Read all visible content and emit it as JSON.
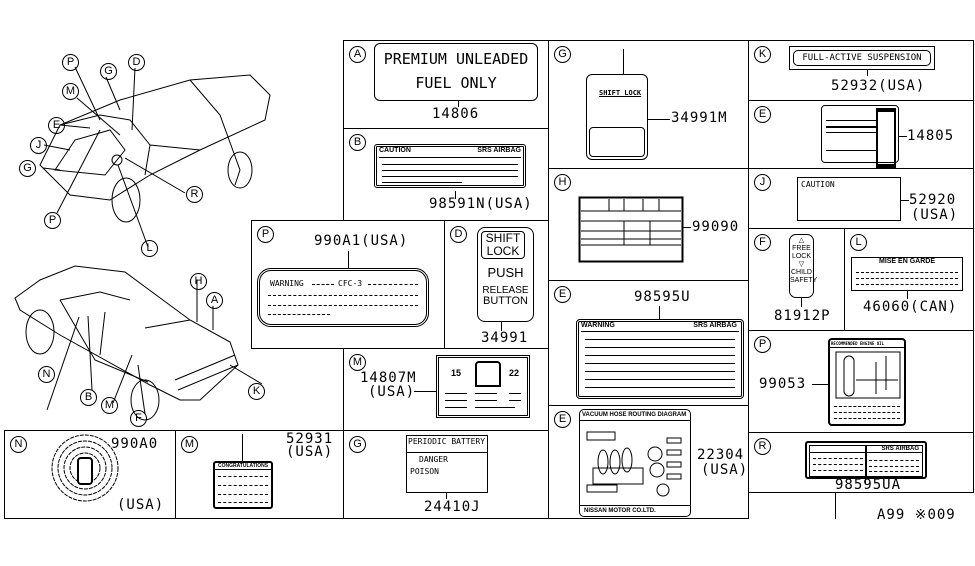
{
  "car_diagrams": {
    "front_car_callouts": [
      "P",
      "G",
      "D",
      "M",
      "E",
      "J",
      "G",
      "R",
      "P",
      "L"
    ],
    "rear_car_callouts": [
      "H",
      "A",
      "N",
      "B",
      "M",
      "F",
      "K"
    ]
  },
  "panels": {
    "A": {
      "letter": "A",
      "part": "14806",
      "label_line1": "PREMIUM UNLEADED",
      "label_line2": "FUEL ONLY"
    },
    "B": {
      "letter": "B",
      "part": "98591N(USA)",
      "label_left": "CAUTION",
      "label_right": "SRS AIRBAG"
    },
    "P1": {
      "letter": "P",
      "part": "990A1(USA)",
      "label_text": "WARNING",
      "label_code": "CFC-3"
    },
    "D": {
      "letter": "D",
      "part": "34991",
      "line1": "SHIFT",
      "line2": "LOCK",
      "line3": "PUSH",
      "line4": "RELEASE",
      "line5": "BUTTON"
    },
    "M1": {
      "letter": "M",
      "part_line1": "14807M",
      "part_line2": "(USA)",
      "left_num": "15",
      "right_num": "22"
    },
    "G1": {
      "letter": "G",
      "part": "24410J",
      "title": "PERIODIC BATTERY",
      "line1": "DANGER",
      "line2": "POISON"
    },
    "N": {
      "letter": "N",
      "part": "990A0",
      "region": "(USA)"
    },
    "M2": {
      "letter": "M",
      "part_line1": "52931",
      "part_line2": "(USA)",
      "title": "CONGRATULATIONS"
    },
    "G2": {
      "letter": "G",
      "part": "34991M",
      "title": "SHIFT LOCK"
    },
    "H": {
      "letter": "H",
      "part": "99090"
    },
    "E1": {
      "letter": "E",
      "part": "98595U",
      "label_left": "WARNING",
      "label_right": "SRS AIRBAG"
    },
    "E2": {
      "letter": "E",
      "part_line1": "22304",
      "part_line2": "(USA)",
      "title": "VACUUM HOSE ROUTING DIAGRAM",
      "footer": "NISSAN MOTOR CO.LTD."
    },
    "K": {
      "letter": "K",
      "part": "52932(USA)",
      "label": "FULL-ACTIVE SUSPENSION"
    },
    "E3": {
      "letter": "E",
      "part": "14805"
    },
    "J": {
      "letter": "J",
      "part_line1": "52920",
      "part_line2": "(USA)",
      "label": "CAUTION"
    },
    "F": {
      "letter": "F",
      "part": "81912P",
      "line1": "FREE",
      "line2": "LOCK",
      "line3": "CHILD",
      "line4": "SAFETY"
    },
    "L": {
      "letter": "L",
      "part": "46060(CAN)",
      "title": "MISE EN GARDE"
    },
    "P2": {
      "letter": "P",
      "part": "99053",
      "title": "RECOMMENDED ENGINE OIL"
    },
    "R": {
      "letter": "R",
      "part": "98595UA",
      "label_right": "SRS AIRBAG"
    }
  },
  "footer": {
    "code": "A99 ※009"
  }
}
